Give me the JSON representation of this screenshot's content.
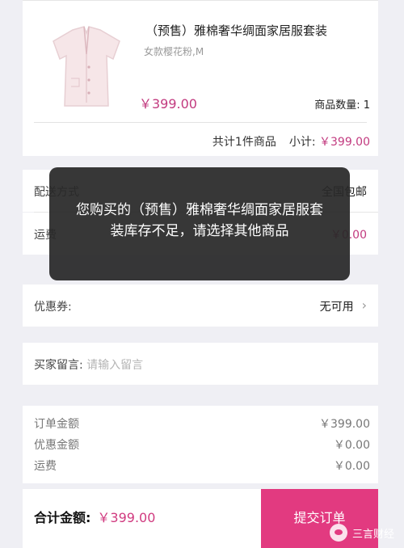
{
  "product": {
    "title": "（预售）雅棉奢华绸面家居服套装",
    "variant": "女款樱花粉,M",
    "price": "￥399.00",
    "quantity_label": "商品数量: 1",
    "summary_count": "共计1件商品",
    "summary_subtotal_label": "小计:",
    "summary_subtotal_value": "￥399.00",
    "image_icon": "pajama-shirt-icon"
  },
  "delivery": {
    "label": "配送方式",
    "value": "全国包邮"
  },
  "shipping_row": {
    "label": "运费",
    "value": "￥0.00"
  },
  "coupon": {
    "label": "优惠券:",
    "value": "无可用"
  },
  "message": {
    "label": "买家留言:",
    "placeholder": "请输入留言"
  },
  "totals": {
    "rows": [
      {
        "label": "订单金额",
        "value": "￥399.00"
      },
      {
        "label": "优惠金额",
        "value": "￥0.00"
      },
      {
        "label": "运费",
        "value": "￥0.00"
      }
    ]
  },
  "bottom": {
    "total_label": "合计金额:",
    "total_value": "￥399.00",
    "submit_label": "提交订单"
  },
  "toast": {
    "line1": "您购买的（预售）雅棉奢华绸面家居服套",
    "line2": "装库存不足，请选择其他商品"
  },
  "watermark": {
    "text": "三言财经"
  },
  "colors": {
    "accent": "#e23a80",
    "price": "#c23a7f"
  }
}
